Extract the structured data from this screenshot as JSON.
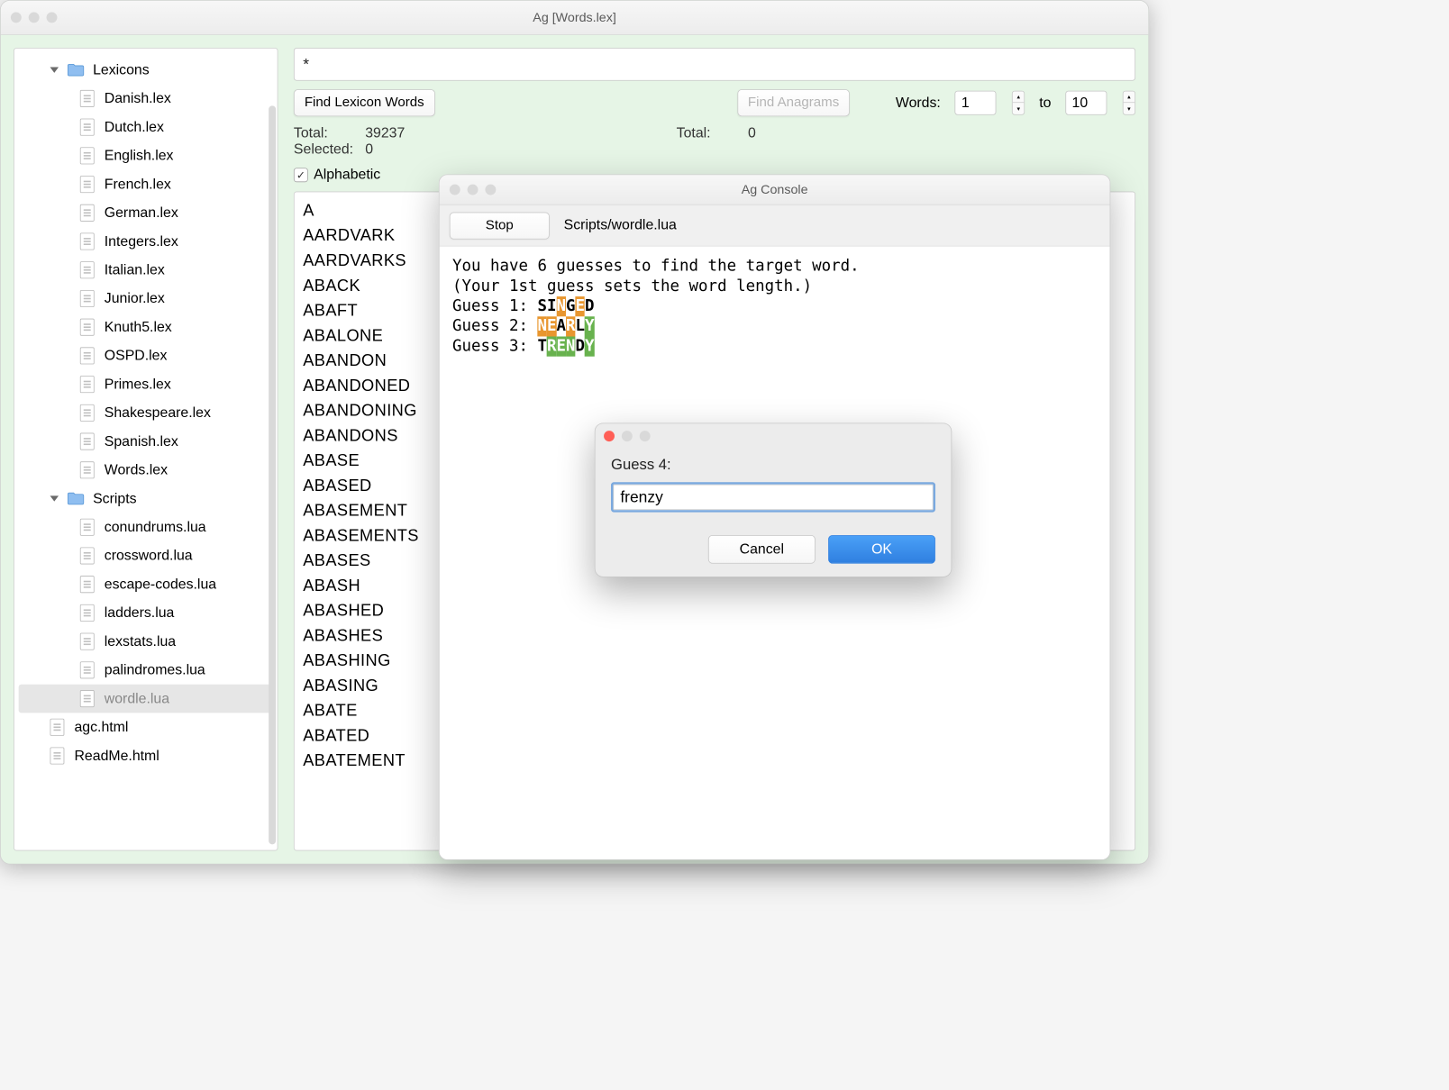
{
  "main_window": {
    "title": "Ag [Words.lex]"
  },
  "sidebar": {
    "groups": [
      {
        "name": "Lexicons",
        "items": [
          "Danish.lex",
          "Dutch.lex",
          "English.lex",
          "French.lex",
          "German.lex",
          "Integers.lex",
          "Italian.lex",
          "Junior.lex",
          "Knuth5.lex",
          "OSPD.lex",
          "Primes.lex",
          "Shakespeare.lex",
          "Spanish.lex",
          "Words.lex"
        ]
      },
      {
        "name": "Scripts",
        "items": [
          "conundrums.lua",
          "crossword.lua",
          "escape-codes.lua",
          "ladders.lua",
          "lexstats.lua",
          "palindromes.lua",
          "wordle.lua"
        ],
        "selected_index": 6
      }
    ],
    "loose_items": [
      "agc.html",
      "ReadMe.html"
    ]
  },
  "main_panel": {
    "search_value": "*",
    "find_lexicon_label": "Find Lexicon Words",
    "find_anagrams_label": "Find Anagrams",
    "words_label": "Words:",
    "words_from": "1",
    "words_to_label": "to",
    "words_to": "10",
    "total_left_label": "Total:",
    "total_left_value": "39237",
    "selected_label": "Selected:",
    "selected_value": "0",
    "total_right_label": "Total:",
    "total_right_value": "0",
    "alphabetic_label": "Alphabetic",
    "alphabetic_checked": true,
    "word_list": [
      "A",
      "AARDVARK",
      "AARDVARKS",
      "ABACK",
      "ABAFT",
      "ABALONE",
      "ABANDON",
      "ABANDONED",
      "ABANDONING",
      "ABANDONS",
      "ABASE",
      "ABASED",
      "ABASEMENT",
      "ABASEMENTS",
      "ABASES",
      "ABASH",
      "ABASHED",
      "ABASHES",
      "ABASHING",
      "ABASING",
      "ABATE",
      "ABATED",
      "ABATEMENT"
    ]
  },
  "console": {
    "title": "Ag Console",
    "stop_label": "Stop",
    "script_path": "Scripts/wordle.lua",
    "intro_line1": "You have 6 guesses to find the target word.",
    "intro_line2": "(Your 1st guess sets the word length.)",
    "guesses": [
      {
        "n": 1,
        "letters": [
          {
            "ch": "S",
            "c": "plain"
          },
          {
            "ch": "I",
            "c": "plain"
          },
          {
            "ch": "N",
            "c": "orange"
          },
          {
            "ch": "G",
            "c": "plain"
          },
          {
            "ch": "E",
            "c": "orange"
          },
          {
            "ch": "D",
            "c": "plain"
          }
        ]
      },
      {
        "n": 2,
        "letters": [
          {
            "ch": "N",
            "c": "orange"
          },
          {
            "ch": "E",
            "c": "orange"
          },
          {
            "ch": "A",
            "c": "plain"
          },
          {
            "ch": "R",
            "c": "orange"
          },
          {
            "ch": "L",
            "c": "plain"
          },
          {
            "ch": "Y",
            "c": "green"
          }
        ]
      },
      {
        "n": 3,
        "letters": [
          {
            "ch": "T",
            "c": "plain"
          },
          {
            "ch": "R",
            "c": "green"
          },
          {
            "ch": "E",
            "c": "green"
          },
          {
            "ch": "N",
            "c": "green"
          },
          {
            "ch": "D",
            "c": "plain"
          },
          {
            "ch": "Y",
            "c": "green"
          }
        ]
      }
    ]
  },
  "prompt": {
    "label": "Guess 4:",
    "value": "frenzy",
    "cancel_label": "Cancel",
    "ok_label": "OK"
  }
}
